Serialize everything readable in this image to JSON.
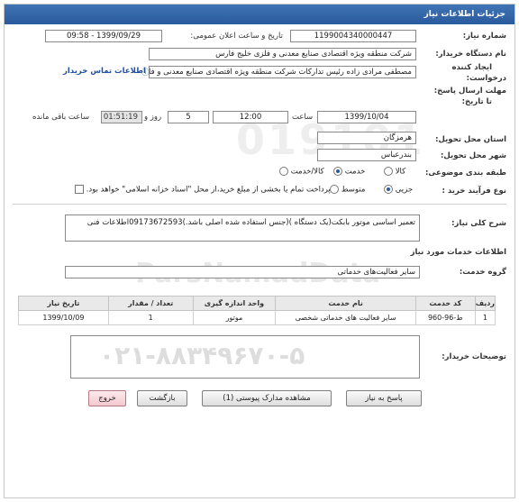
{
  "header": {
    "title": "جزئیات اطلاعات نیاز"
  },
  "fields": {
    "need_number_label": "شماره نیاز:",
    "need_number": "1199004340000447",
    "announce_label": "تاریخ و ساعت اعلان عمومی:",
    "announce_value": "1399/09/29 - 09:58",
    "buyer_label": "نام دستگاه خریدار:",
    "buyer_value": "شرکت منطقه ویژه اقتصادی صنایع معدنی و فلزی خلیج فارس",
    "creator_label_1": "ایجاد کننده",
    "creator_label_2": "درخواست:",
    "creator_value": "مصطفی مرادی زاده رئیس تدارکات شرکت منطقه ویژه اقتصادی صنایع معدنی و فلزی",
    "contact_link": "اطلاعات تماس خریدار",
    "deadline_label_1": "مهلت ارسال پاسخ:",
    "deadline_label_2": "تا تاریخ:",
    "deadline_date": "1399/10/04",
    "time_label": "ساعت",
    "deadline_time": "12:00",
    "days_value": "5",
    "days_label": "روز و",
    "timer_value": "01:51:19",
    "remaining_label": "ساعت باقی مانده",
    "province_label": "استان محل تحویل:",
    "province_value": "هرمزگان",
    "city_label": "شهر محل تحویل:",
    "city_value": "بندرعباس",
    "category_label": "طبقه بندی موضوعی:",
    "category_options": [
      "کالا",
      "خدمت",
      "کالا/خدمت"
    ],
    "category_selected": "خدمت",
    "purchase_label": "نوع فرآیند خرید :",
    "purchase_options": [
      "جزیی",
      "متوسط"
    ],
    "purchase_selected": "جزیی",
    "payment_note": "پرداخت تمام یا بخشی از مبلغ خرید،از محل \"اسناد خزانه اسلامی\" خواهد بود."
  },
  "description": {
    "label": "شرح کلی نیاز:",
    "text": "تعمیر اساسی موتور بابکت(یک دستگاه )(جنس استفاده شده اصلی باشد.)09173672593اطلاعات فنی"
  },
  "services": {
    "section_title": "اطلاعات خدمات مورد نیاز",
    "group_label": "گروه خدمت:",
    "group_value": "سایر فعالیت‌های خدماتی",
    "table": {
      "headers": [
        "ردیف",
        "کد خدمت",
        "نام خدمت",
        "واحد اندازه گیری",
        "تعداد / مقدار",
        "تاریخ نیاز"
      ],
      "rows": [
        [
          "1",
          "ط-96-960",
          "سایر فعالیت های خدماتی شخصی",
          "موتور",
          "1",
          "1399/10/09"
        ]
      ]
    }
  },
  "buyer_notes": {
    "label": "توضیحات خریدار:",
    "phone_watermark": "۰۲۱-۸۸۳۴۹۶۷۰-۵"
  },
  "watermark": {
    "logo_text": "ParsNamadData",
    "number": "019101"
  },
  "buttons": {
    "reply": "پاسخ به نیاز",
    "attachments": "مشاهده مدارک پیوستی (1)",
    "back": "بازگشت",
    "exit": "خروج"
  },
  "colors": {
    "header_bg": "#2a5b9c",
    "link": "#1f4fa0",
    "exit_button": "#f4c8cf"
  }
}
